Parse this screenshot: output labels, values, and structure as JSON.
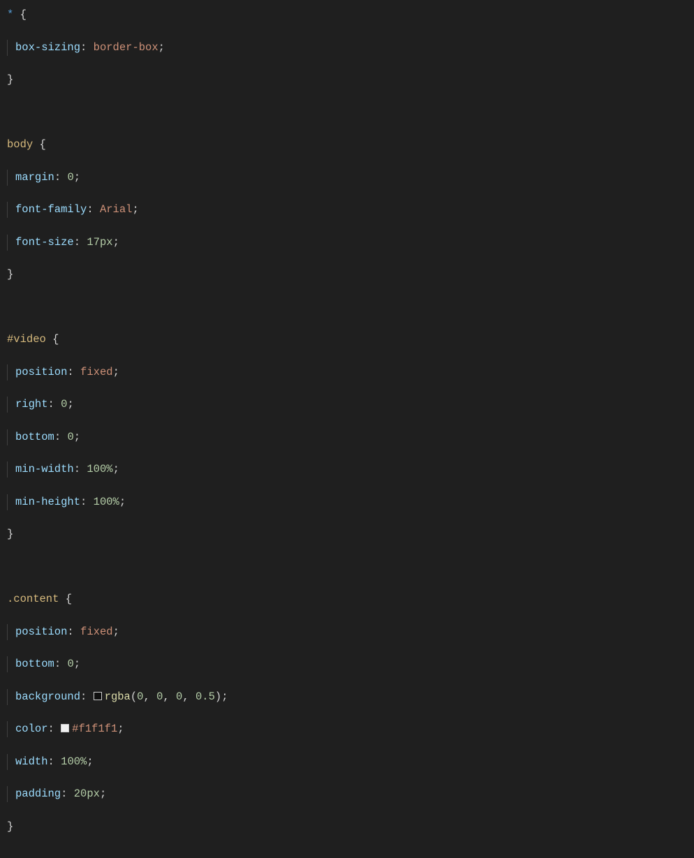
{
  "editor": {
    "language": "css",
    "colors": {
      "background": "#1f1f1f",
      "selector": "#d7ba7d",
      "property": "#9cdcfe",
      "keyword": "#ce9178",
      "number": "#b5cea8",
      "function": "#dcdcaa",
      "starSelector": "#569cd6",
      "punctuation": "#d4d4d4",
      "indentGuide": "#404040",
      "swatchBorder": "#cccccc"
    },
    "rules": [
      {
        "selector": "*",
        "declarations": [
          {
            "property": "box-sizing",
            "value": "border-box"
          }
        ]
      },
      {
        "selector": "body",
        "declarations": [
          {
            "property": "margin",
            "value": "0"
          },
          {
            "property": "font-family",
            "value": "Arial"
          },
          {
            "property": "font-size",
            "value": "17px"
          }
        ]
      },
      {
        "selector": "#video",
        "declarations": [
          {
            "property": "position",
            "value": "fixed"
          },
          {
            "property": "right",
            "value": "0"
          },
          {
            "property": "bottom",
            "value": "0"
          },
          {
            "property": "min-width",
            "value": "100%"
          },
          {
            "property": "min-height",
            "value": "100%"
          }
        ]
      },
      {
        "selector": ".content",
        "declarations": [
          {
            "property": "position",
            "value": "fixed"
          },
          {
            "property": "bottom",
            "value": "0"
          },
          {
            "property": "background",
            "value": "rgba(0, 0, 0, 0.5)",
            "swatch": "rgba(0,0,0,0.5)"
          },
          {
            "property": "color",
            "value": "#f1f1f1",
            "swatch": "#f1f1f1"
          },
          {
            "property": "width",
            "value": "100%"
          },
          {
            "property": "padding",
            "value": "20px"
          }
        ]
      }
    ]
  }
}
